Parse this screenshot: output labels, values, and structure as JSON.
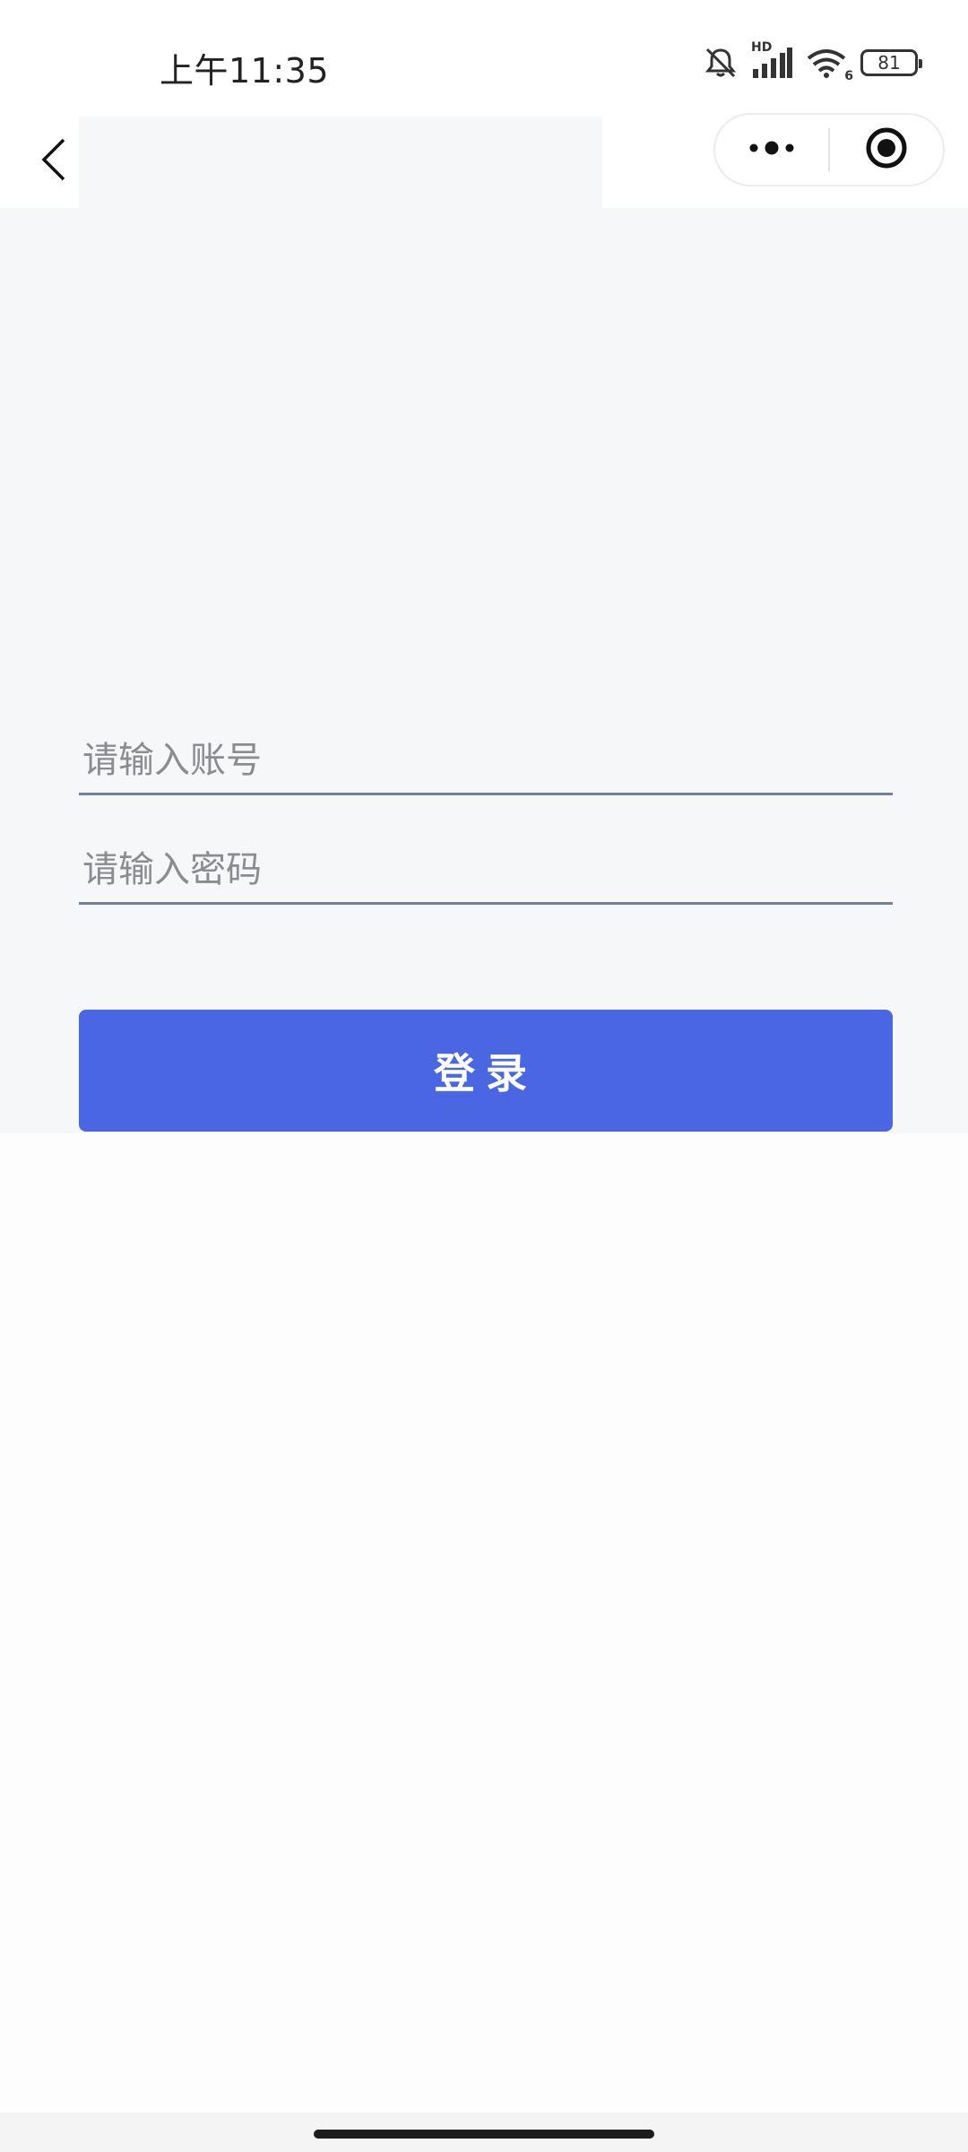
{
  "status_bar": {
    "time": "上午11:35",
    "network_label": "HD",
    "wifi_label": "6",
    "battery_level": "81"
  },
  "nav_bar": {
    "back_icon": "chevron-left-icon",
    "more_icon": "more-dots-icon",
    "close_icon": "target-circle-icon"
  },
  "login_form": {
    "account_placeholder": "请输入账号",
    "password_placeholder": "请输入密码",
    "login_label": "登录"
  },
  "colors": {
    "primary_button": "#4a66e2",
    "content_background": "#f6f7f9",
    "input_underline": "#6f7f9c"
  }
}
